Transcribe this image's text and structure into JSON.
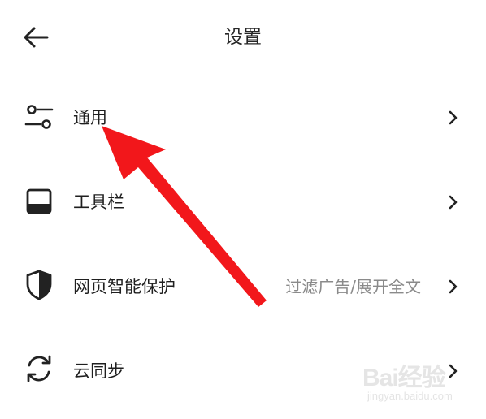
{
  "header": {
    "title": "设置",
    "back_icon": "arrow-left-icon"
  },
  "settings": {
    "items": [
      {
        "label": "通用",
        "value": "",
        "icon": "sliders-icon"
      },
      {
        "label": "工具栏",
        "value": "",
        "icon": "toolbar-icon"
      },
      {
        "label": "网页智能保护",
        "value": "过滤广告/展开全文",
        "icon": "shield-icon"
      },
      {
        "label": "云同步",
        "value": "",
        "icon": "sync-icon"
      }
    ],
    "chevron_icon": "chevron-right-icon"
  },
  "annotation": {
    "arrow_color": "#f2171b"
  },
  "watermark": {
    "brand": "Bai经验",
    "url": "jingyan.baidu.com"
  },
  "colors": {
    "text": "#1f1f1f",
    "secondary_text": "#8a8a8a",
    "background": "#ffffff"
  }
}
